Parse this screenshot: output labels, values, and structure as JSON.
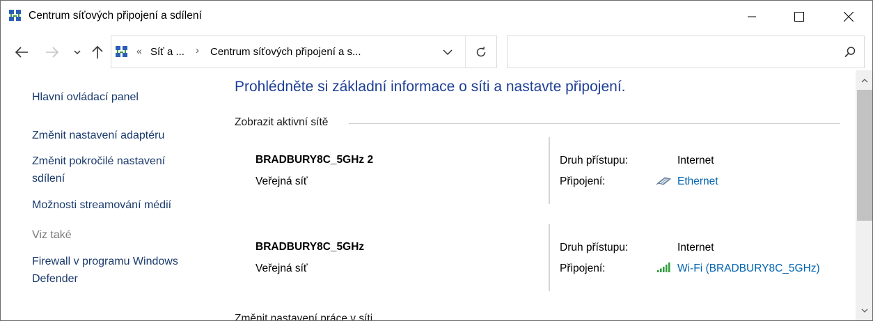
{
  "window": {
    "title": "Centrum síťových připojení a sdílení",
    "icon": "network-center-icon"
  },
  "navigation": {
    "back_icon": "arrow-left-icon",
    "forward_icon": "arrow-right-icon",
    "recent_icon": "chevron-down-icon",
    "up_icon": "arrow-up-icon"
  },
  "address_bar": {
    "overflow_chevron": "«",
    "segment_1": "Síť a ...",
    "separator": "›",
    "segment_2": "Centrum síťových připojení a s..."
  },
  "search": {
    "value": "",
    "placeholder": ""
  },
  "sidebar": {
    "home_link": "Hlavní ovládací panel",
    "links": [
      "Změnit nastavení adaptéru",
      "Změnit pokročilé nastavení",
      "sdílení",
      "Možnosti streamování médií"
    ],
    "see_also_label": "Viz také",
    "see_also_links": [
      "Firewall v programu Windows",
      "Defender"
    ]
  },
  "main": {
    "heading": "Prohlédněte si základní informace o síti a nastavte připojení.",
    "active_networks_label": "Zobrazit aktivní sítě",
    "networks": [
      {
        "name": "BRADBURY8C_5GHz 2",
        "category": "Veřejná síť",
        "access_type_label": "Druh přístupu:",
        "access_type": "Internet",
        "connection_label": "Připojení:",
        "connection": "Ethernet",
        "connection_icon": "ethernet-icon"
      },
      {
        "name": "BRADBURY8C_5GHz",
        "category": "Veřejná síť",
        "access_type_label": "Druh přístupu:",
        "access_type": "Internet",
        "connection_label": "Připojení:",
        "connection": "Wi-Fi (BRADBURY8C_5GHz)",
        "connection_icon": "wifi-signal-icon"
      }
    ],
    "change_settings_label": "Změnit nastavení práce v síti"
  },
  "colors": {
    "heading": "#1e3f96",
    "link": "#0063b1",
    "sidebar_link": "#1a3a6c",
    "wifi_signal": "#2e9e3b"
  }
}
